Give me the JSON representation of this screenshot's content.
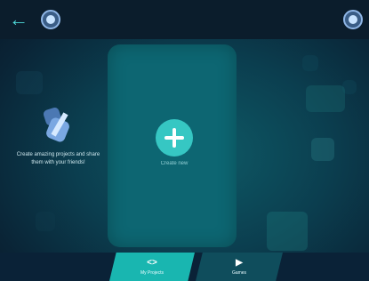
{
  "topbar": {
    "back_icon": "←"
  },
  "main": {
    "add_label": "Create new",
    "promo_text": "Create amazing projects and share them with your friends!"
  },
  "bottom_tabs": [
    {
      "label": "My Projects",
      "icon": "<>"
    },
    {
      "label": "Games",
      "icon": "▶"
    }
  ],
  "colors": {
    "accent": "#36c7c3",
    "panel": "#0d6672",
    "tab_active": "#19b6b0",
    "tab_inactive": "#0f4d5c",
    "topbar": "#0b1d2c"
  }
}
